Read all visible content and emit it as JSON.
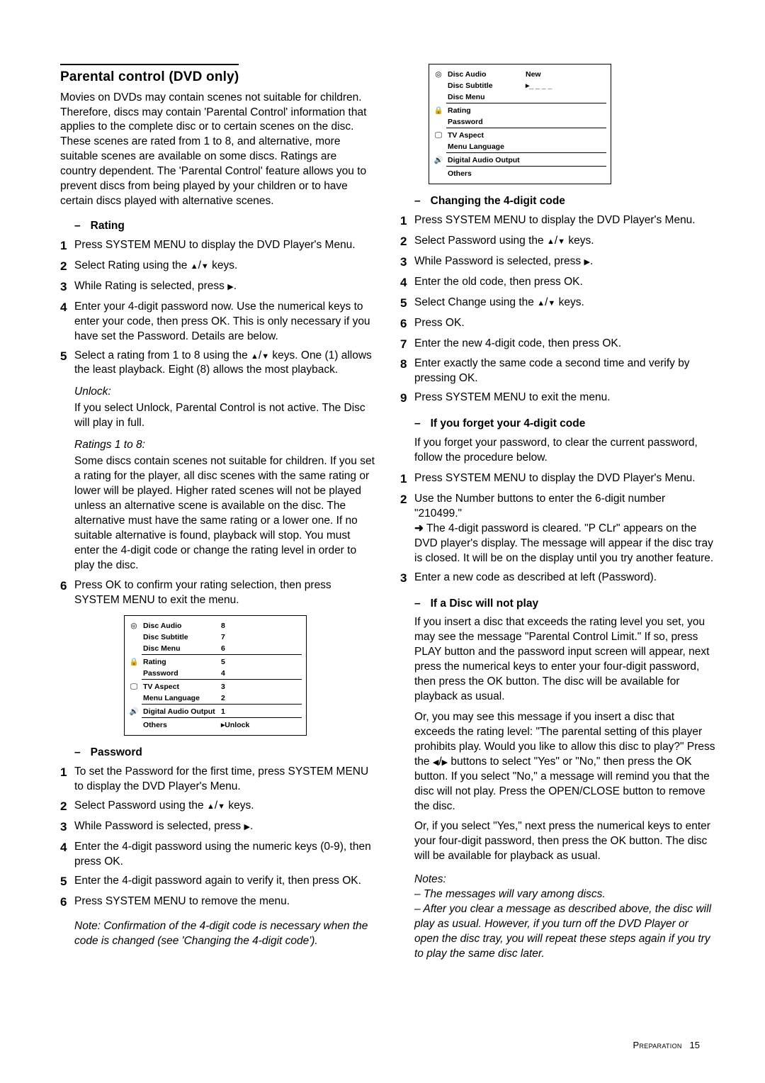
{
  "title": "Parental control (DVD only)",
  "intro": "Movies on DVDs may contain scenes not suitable for children. Therefore, discs may contain 'Parental Control' information that applies to the complete disc or to certain scenes on the disc. These scenes are rated from 1 to 8, and alternative, more suitable scenes are available on some discs. Ratings are country dependent. The 'Parental Control' feature allows you to prevent discs from being played by your children or to have certain discs played with alternative scenes.",
  "rating": {
    "heading": "Rating",
    "s1": "Press SYSTEM MENU to display the DVD Player's Menu.",
    "s2": "Select Rating using the __UP__/__DN__ keys.",
    "s3": "While Rating is selected, press __RT__.",
    "s4": "Enter your 4-digit password now. Use the numerical keys to enter your code, then press OK. This is only necessary if you have set the Password. Details are below.",
    "s5": "Select a rating from 1 to 8 using the __UP__/__DN__ keys. One (1) allows the least playback. Eight (8) allows the most playback.",
    "unlock_lbl": "Unlock:",
    "unlock": "If you select Unlock, Parental Control is not active. The Disc will play in full.",
    "ratings_lbl": "Ratings 1 to 8:",
    "ratings_body": "Some discs contain scenes not suitable for children. If you set a rating for the player, all disc scenes with the same rating or lower will be played. Higher rated scenes will not be played unless an alternative scene is available on the disc. The alternative must have the same rating or a lower one. If no suitable alternative is found, playback will stop. You must enter the 4-digit code or change the rating level in order to play the disc.",
    "s6": "Press OK to confirm your rating selection, then press SYSTEM MENU to exit the menu."
  },
  "menu1": {
    "i1": "Disc Audio",
    "v1": "8",
    "i2": "Disc Subtitle",
    "v2": "7",
    "i3": "Disc Menu",
    "v3": "6",
    "i4": "Rating",
    "v4": "5",
    "i5": "Password",
    "v5": "4",
    "i6": "TV Aspect",
    "v6": "3",
    "i7": "Menu Language",
    "v7": "2",
    "i8": "Digital Audio Output",
    "v8": "1",
    "i9": "Others",
    "v9": "Unlock"
  },
  "password": {
    "heading": "Password",
    "s1": "To set the Password for the first time, press SYSTEM MENU to display the DVD Player's Menu.",
    "s2": "Select Password using the __UP__/__DN__ keys.",
    "s3": "While Password is selected, press __RT__.",
    "s4": "Enter the 4-digit password using the numeric keys (0-9), then press OK.",
    "s5": "Enter the 4-digit password again to verify it, then press OK.",
    "s6": "Press SYSTEM MENU to remove the menu.",
    "note": "Note: Confirmation of the 4-digit code is necessary when the code is changed (see 'Changing the 4-digit code')."
  },
  "menu2": {
    "i1": "Disc Audio",
    "v1": "New",
    "i2": "Disc Subtitle",
    "v2": "_ _ _ _",
    "i3": "Disc Menu",
    "i4": "Rating",
    "i5": "Password",
    "i6": "TV Aspect",
    "i7": "Menu Language",
    "i8": "Digital Audio Output",
    "i9": "Others"
  },
  "changing": {
    "heading": "Changing the 4-digit code",
    "s1": "Press SYSTEM MENU to display the DVD Player's Menu.",
    "s2": "Select Password using the __UP__/__DN__ keys.",
    "s3": "While Password is selected, press __RT__.",
    "s4": "Enter the old code, then press OK.",
    "s5": "Select Change using the __UP__/__DN__ keys.",
    "s6": "Press OK.",
    "s7": "Enter the new 4-digit code, then press OK.",
    "s8": "Enter exactly the same code a second time and verify by pressing OK.",
    "s9": "Press SYSTEM MENU to exit the menu."
  },
  "forgot": {
    "heading": "If you forget your 4-digit code",
    "intro": "If you forget your password, to clear the current password, follow the procedure below.",
    "s1": "Press SYSTEM MENU to display the DVD Player's Menu.",
    "s2": "Use the Number buttons to enter the 6-digit number \"210499.\"",
    "res": "The 4-digit password is cleared. \"P CLr\" appears on the DVD player's display. The message will appear if the disc tray is closed. It will be on the display until you try another feature.",
    "s3": "Enter a new code as described at left (Password)."
  },
  "noplay": {
    "heading": "If a Disc will not play",
    "p1": "If you insert a disc that exceeds the rating level you set, you may see the message \"Parental Control Limit.\"  If so, press PLAY button and the password input screen will appear, next press the numerical keys to enter your four-digit password, then press the OK button. The disc will be available for playback as usual.",
    "p2": "Or, you may see this message if you insert a disc that exceeds the rating level: \"The parental setting of this player prohibits play. Would you like to allow this disc to play?\" Press the __LT__/__RT__ buttons to select \"Yes\" or \"No,\"  then press the OK button. If you select \"No,\" a message will remind you that the disc will not play. Press the OPEN/CLOSE button to remove the disc.",
    "p3": "Or, if you select \"Yes,\" next press the numerical keys to enter your four-digit password, then press the OK button. The disc will be available for playback as usual.",
    "notes_lbl": "Notes:",
    "n1": "The messages will vary among discs.",
    "n2": "After you clear a message as described above, the disc will play as usual. However, if you turn off the DVD Player or open the disc tray, you will repeat these steps again if you try to play the same disc later."
  },
  "footer": {
    "section": "Preparation",
    "page": "15"
  }
}
